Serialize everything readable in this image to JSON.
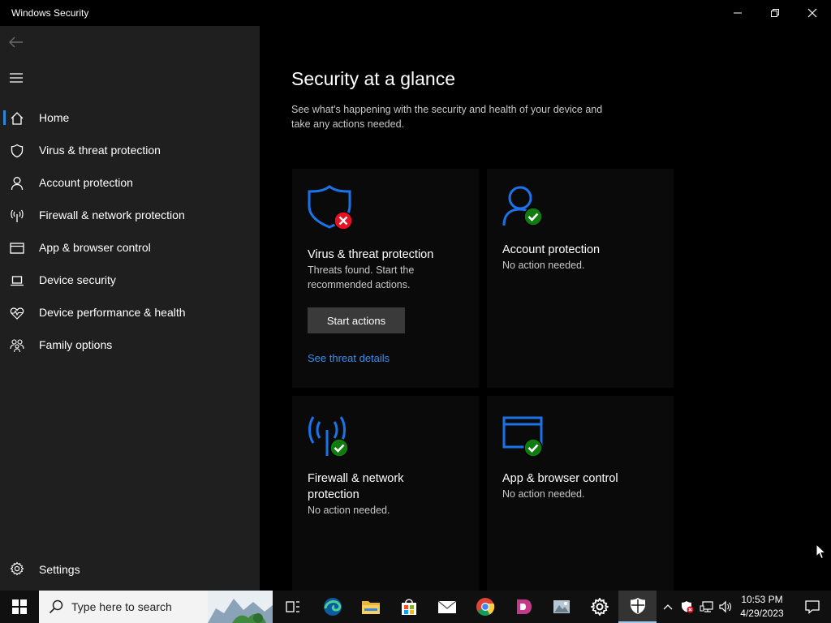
{
  "window": {
    "title": "Windows Security"
  },
  "sidebar": {
    "items": [
      {
        "label": "Home",
        "icon": "home-icon"
      },
      {
        "label": "Virus & threat protection",
        "icon": "shield-icon"
      },
      {
        "label": "Account protection",
        "icon": "person-icon"
      },
      {
        "label": "Firewall & network protection",
        "icon": "antenna-icon"
      },
      {
        "label": "App & browser control",
        "icon": "browser-window-icon"
      },
      {
        "label": "Device security",
        "icon": "laptop-icon"
      },
      {
        "label": "Device performance & health",
        "icon": "heart-pulse-icon"
      },
      {
        "label": "Family options",
        "icon": "family-icon"
      }
    ],
    "active_index": 0,
    "settings_label": "Settings"
  },
  "main": {
    "title": "Security at a glance",
    "description": "See what's happening with the security and health of your device and take any actions needed.",
    "cards": [
      {
        "title": "Virus & threat protection",
        "status": "Threats found. Start the recommended actions.",
        "button": "Start actions",
        "link": "See threat details",
        "state": "error"
      },
      {
        "title": "Account protection",
        "status": "No action needed.",
        "state": "ok"
      },
      {
        "title": "Firewall & network protection",
        "status": "No action needed.",
        "state": "ok"
      },
      {
        "title": "App & browser control",
        "status": "No action needed.",
        "state": "ok"
      }
    ]
  },
  "taskbar": {
    "search_placeholder": "Type here to search",
    "apps": [
      "task-view-icon",
      "edge-icon",
      "file-explorer-icon",
      "store-icon",
      "mail-icon",
      "chrome-icon",
      "app-ds-icon",
      "photos-icon",
      "settings-icon",
      "windows-security-icon"
    ],
    "time": "10:53 PM",
    "date": "4/29/2023"
  },
  "colors": {
    "accent_blue": "#2b88d8",
    "link_blue": "#3b8ee8",
    "icon_blue": "#1a73e8",
    "status_ok": "#107c10",
    "status_error": "#e81123",
    "sidebar_bg": "#1f1f1f",
    "main_bg": "#000000"
  }
}
